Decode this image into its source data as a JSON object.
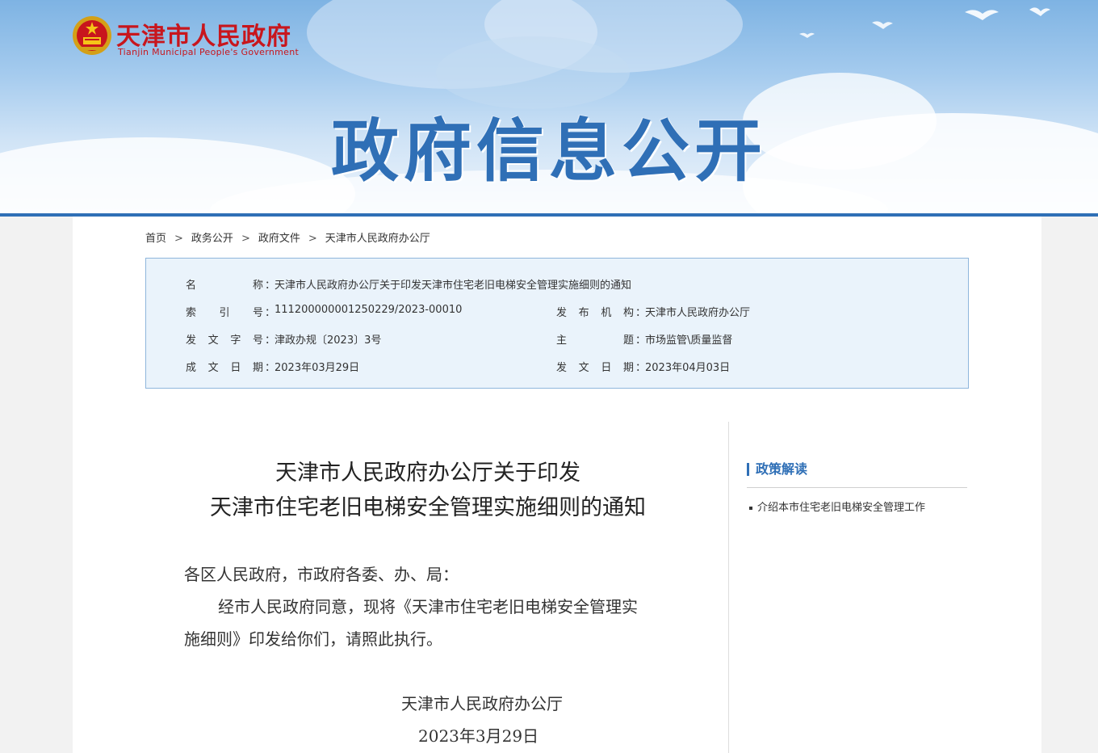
{
  "header": {
    "site_name_cn": "天津市人民政府",
    "site_name_en": "Tianjin Municipal People's Government",
    "section_title": "政府信息公开",
    "colors": {
      "brand_red": "#c8161d",
      "brand_blue": "#2f6fb6"
    }
  },
  "breadcrumb": {
    "items": [
      "首页",
      "政务公开",
      "政府文件",
      "天津市人民政府办公厅"
    ],
    "separator": ">"
  },
  "meta": {
    "name_label": "名称",
    "name_value": "天津市人民政府办公厅关于印发天津市住宅老旧电梯安全管理实施细则的通知",
    "index_label": "索引号",
    "index_value": "111200000001250229/2023-00010",
    "issuer_label": "发布机构",
    "issuer_value": "天津市人民政府办公厅",
    "docno_label": "发文字号",
    "docno_value": "津政办规〔2023〕3号",
    "topic_label": "主题",
    "topic_value": "市场监管\\质量监督",
    "created_label": "成文日期",
    "created_value": "2023年03月29日",
    "published_label": "发文日期",
    "published_value": "2023年04月03日",
    "colon": "："
  },
  "article": {
    "title_line1": "天津市人民政府办公厅关于印发",
    "title_line2": "天津市住宅老旧电梯安全管理实施细则的通知",
    "salutation": "各区人民政府，市政府各委、办、局：",
    "para_line1": "经市人民政府同意，现将《天津市住宅老旧电梯安全管理实",
    "para_line2": "施细则》印发给你们，请照此执行。",
    "signature": "天津市人民政府办公厅",
    "date": "2023年3月29日"
  },
  "sidebar": {
    "title": "政策解读",
    "items": [
      "介绍本市住宅老旧电梯安全管理工作"
    ]
  }
}
